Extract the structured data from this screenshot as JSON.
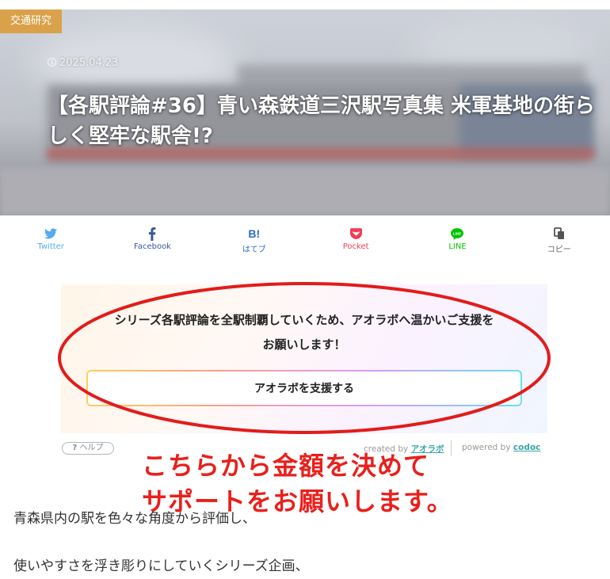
{
  "article": {
    "category": "交通研究",
    "date": "2025.04.23",
    "title": "【各駅評論#36】青い森鉄道三沢駅写真集 米軍基地の街らしく堅牢な駅舎!?"
  },
  "share": [
    {
      "label": "Twitter",
      "icon": "twitter-bird-icon",
      "color": "#55acee"
    },
    {
      "label": "Facebook",
      "icon": "facebook-f-icon",
      "color": "#3b5998"
    },
    {
      "label": "はてブ",
      "icon": "hatena-bookmark-icon",
      "color": "#2c6ebd"
    },
    {
      "label": "Pocket",
      "icon": "pocket-icon",
      "color": "#ef3f56"
    },
    {
      "label": "LINE",
      "icon": "line-icon",
      "color": "#00c300"
    },
    {
      "label": "コピー",
      "icon": "copy-icon",
      "color": "#666666"
    }
  ],
  "support": {
    "message_line1": "シリーズ各駅評論を全駅制覇していくため、アオラボへ温かいご支援を",
    "message_line2": "お願いします！",
    "button_label": "アオラボを支援する",
    "help_label": "ヘルプ",
    "credit_created_prefix": "created by",
    "credit_created_name": "アオラボ",
    "credit_powered_prefix": "powered by",
    "credit_powered_name": "codoc"
  },
  "annotation": {
    "line1": "こちらから金額を決めて",
    "line2": "サポートをお願いします。",
    "color": "#e8201c"
  },
  "body": {
    "p1": "青森県内の駅を色々な角度から評価し、",
    "p2": "使いやすさを浮き彫りにしていくシリーズ企画、"
  }
}
